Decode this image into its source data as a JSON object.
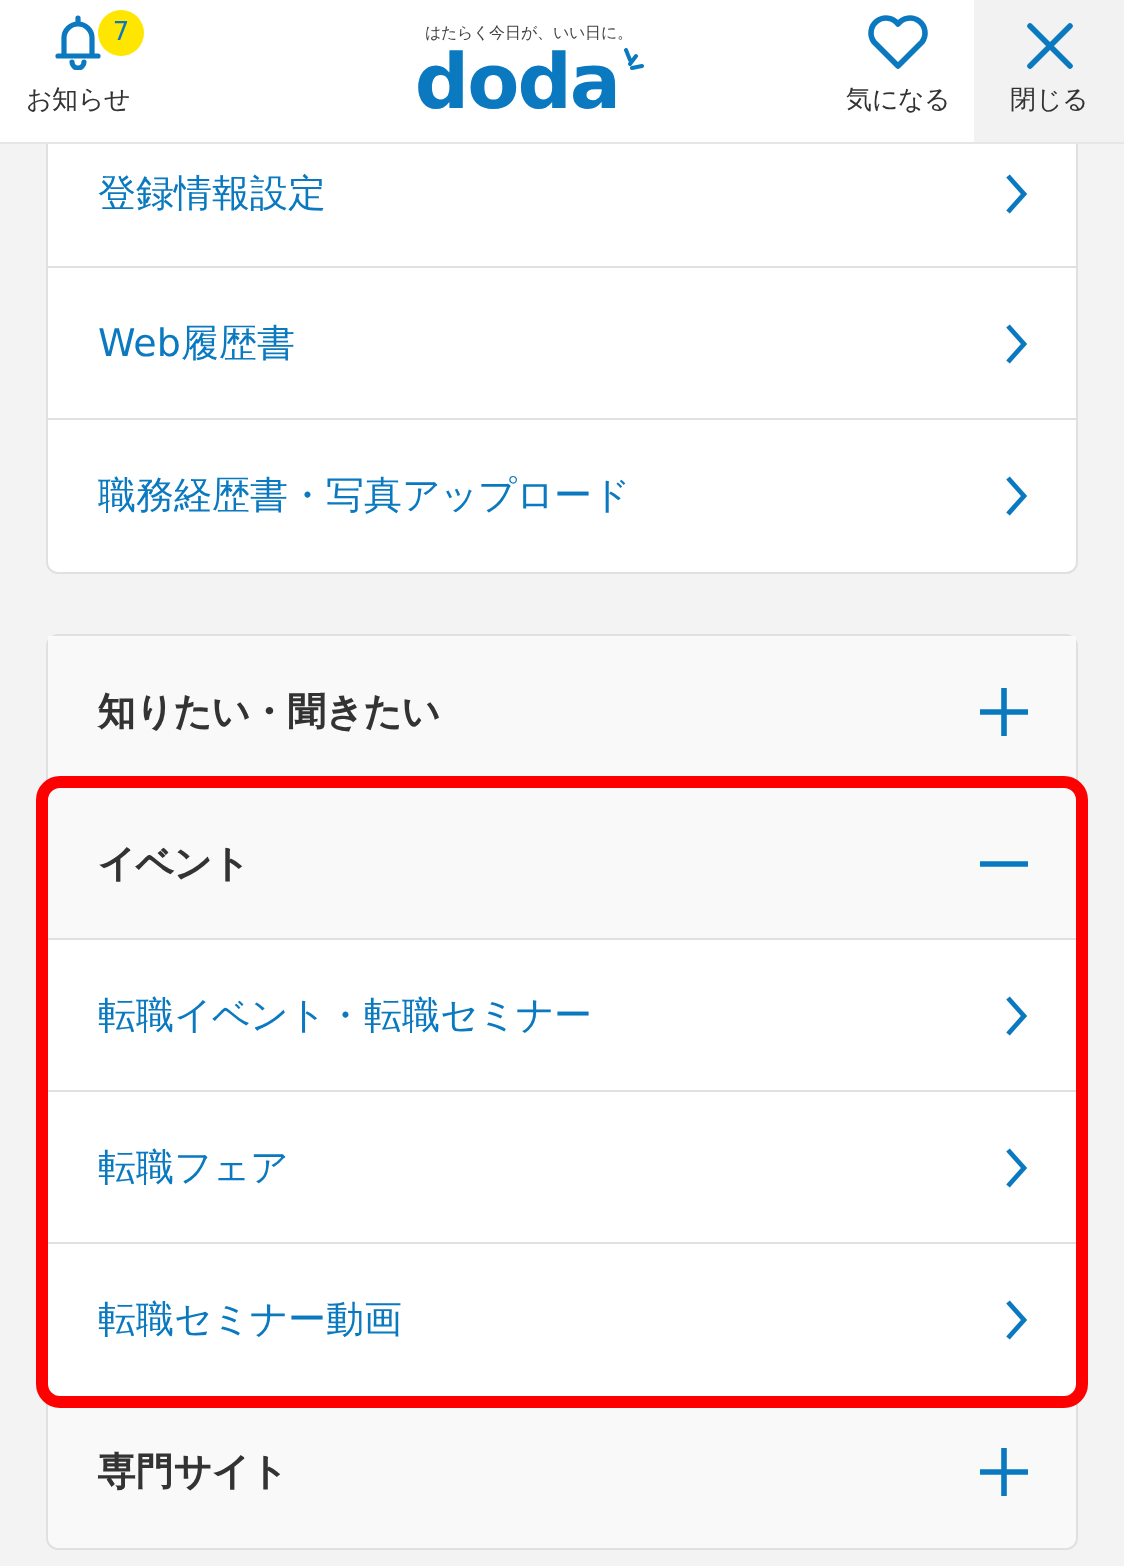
{
  "header": {
    "notice": {
      "label": "お知らせ",
      "badge": "7"
    },
    "tagline": "はたらく今日が、いい日に。",
    "logo": "doda",
    "favorite": "気になる",
    "close": "閉じる"
  },
  "account_links": [
    {
      "label": "登録情報設定"
    },
    {
      "label": "Web履歴書"
    },
    {
      "label": "職務経歴書・写真アップロード"
    }
  ],
  "menu_sections": [
    {
      "title": "知りたい・聞きたい",
      "expanded": false,
      "highlighted": false
    },
    {
      "title": "イベント",
      "expanded": true,
      "highlighted": true,
      "children": [
        {
          "label": "転職イベント・転職セミナー"
        },
        {
          "label": "転職フェア"
        },
        {
          "label": "転職セミナー動画"
        }
      ]
    },
    {
      "title": "専門サイト",
      "expanded": false,
      "highlighted": false
    }
  ]
}
